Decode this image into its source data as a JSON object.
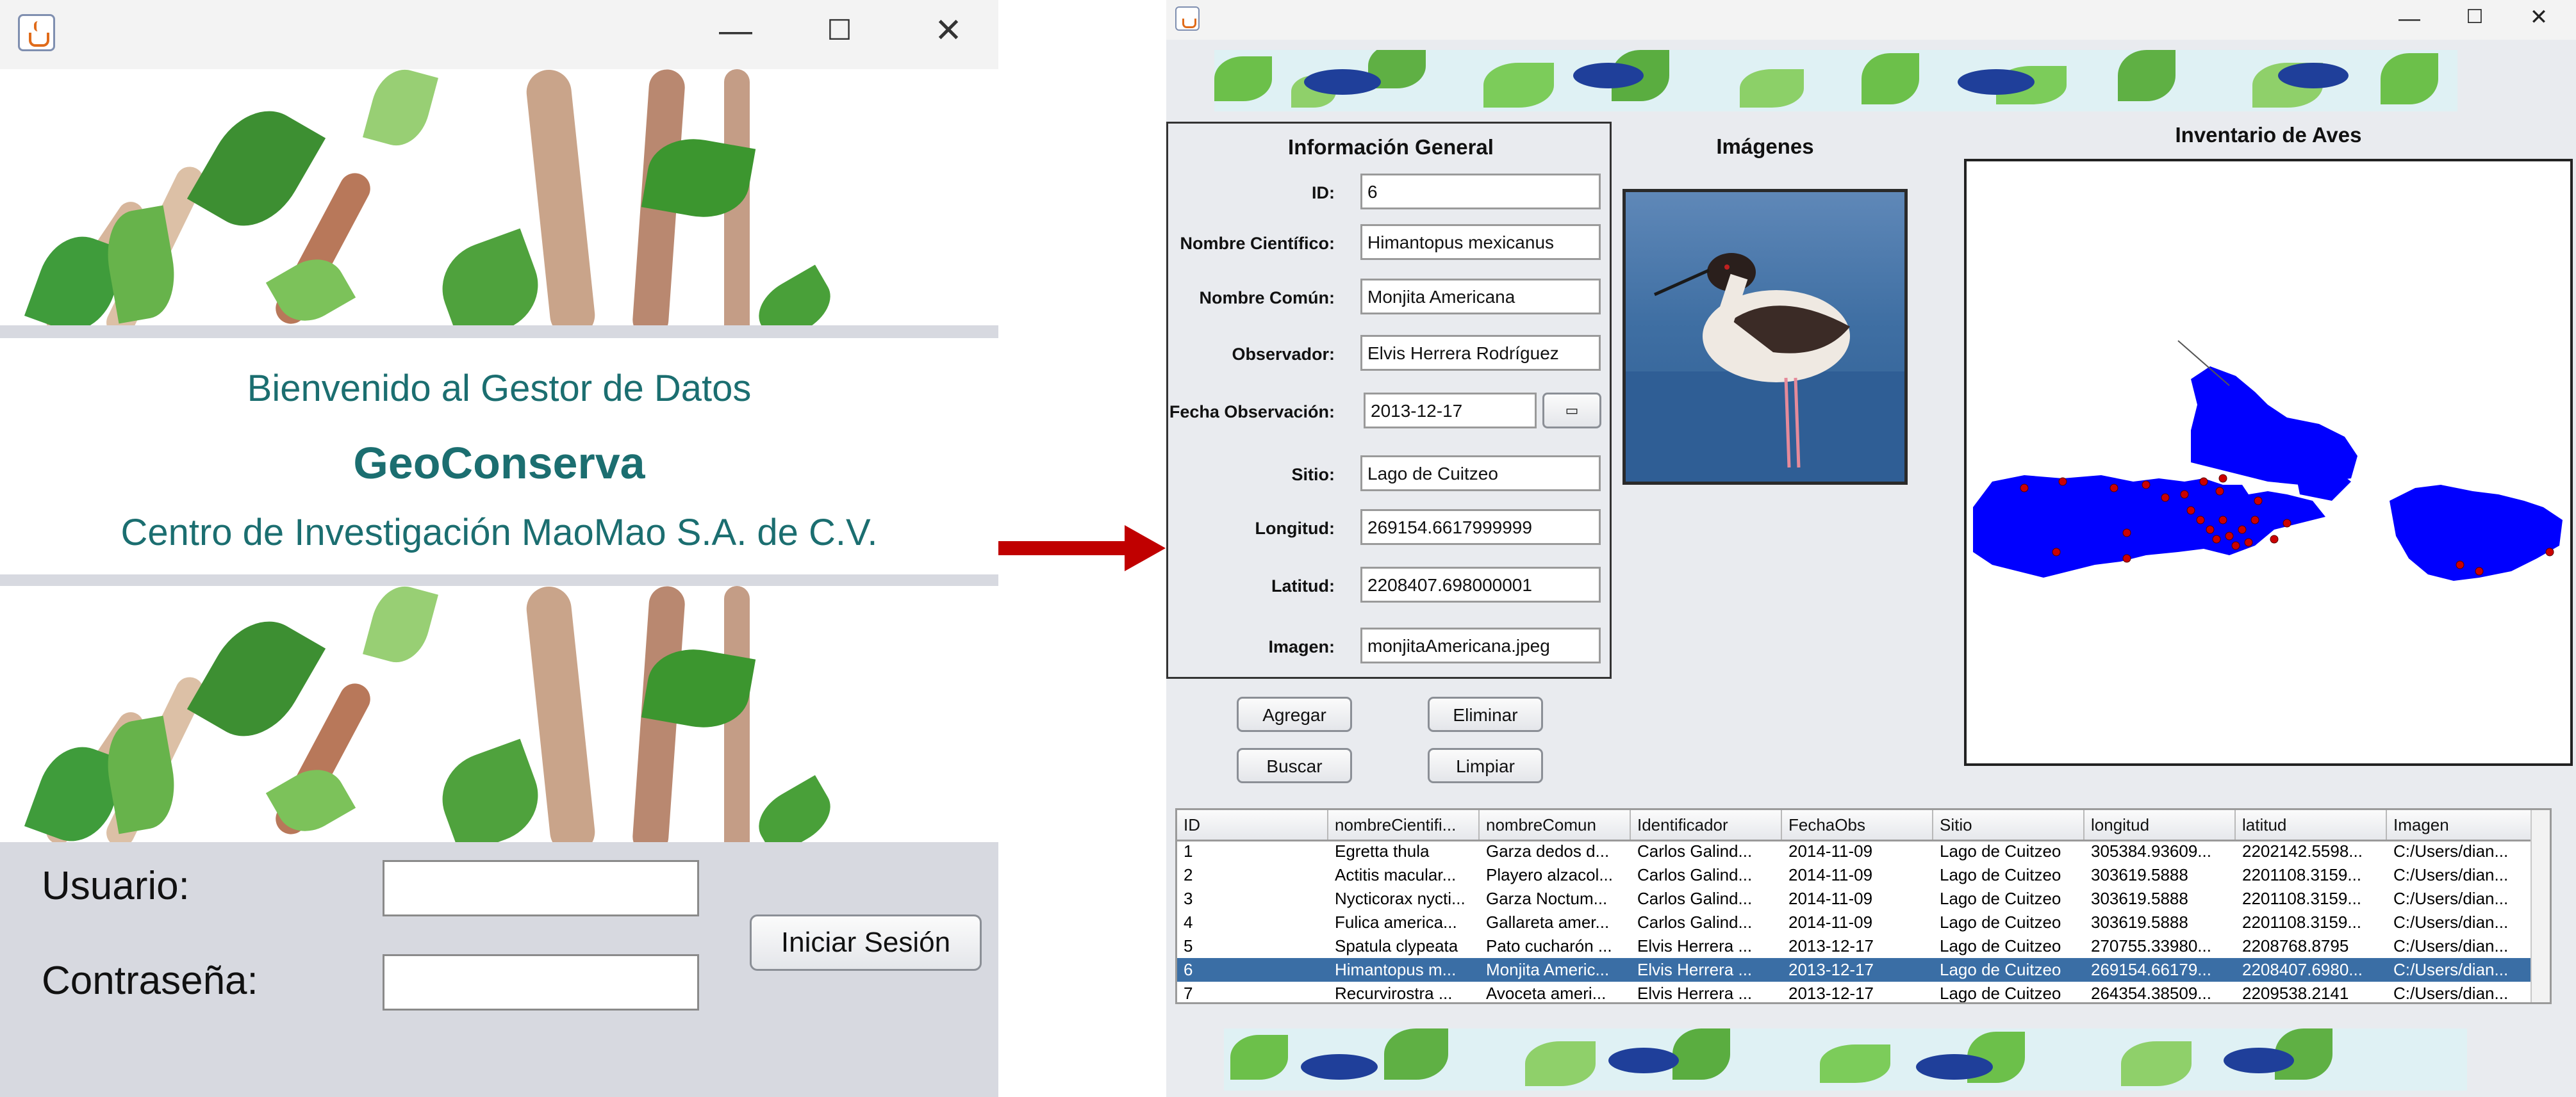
{
  "login": {
    "welcome": "Bienvenido al Gestor de Datos",
    "app_name": "GeoConserva",
    "org": "Centro de Investigación MaoMao S.A. de C.V.",
    "user_label": "Usuario:",
    "user_value": "",
    "password_label": "Contraseña:",
    "password_value": "",
    "login_button": "Iniciar Sesión"
  },
  "main": {
    "info_title": "Información General",
    "images_title": "Imágenes",
    "map_title": "Inventario de Aves",
    "fields": [
      {
        "label": "ID:",
        "value": "6"
      },
      {
        "label": "Nombre Científico:",
        "value": "Himantopus mexicanus"
      },
      {
        "label": "Nombre Común:",
        "value": "Monjita Americana"
      },
      {
        "label": "Observador:",
        "value": "Elvis Herrera Rodríguez"
      },
      {
        "label": "Fecha Observación:",
        "value": "2013-12-17"
      },
      {
        "label": "Sitio:",
        "value": "Lago de Cuitzeo"
      },
      {
        "label": "Longitud:",
        "value": "269154.6617999999"
      },
      {
        "label": "Latitud:",
        "value": "2208407.698000001"
      },
      {
        "label": "Imagen:",
        "value": "monjitaAmericana.jpeg"
      }
    ],
    "buttons": {
      "agregar": "Agregar",
      "eliminar": "Eliminar",
      "buscar": "Buscar",
      "limpiar": "Limpiar"
    },
    "table": {
      "columns": [
        "ID",
        "nombreCientifi...",
        "nombreComun",
        "Identificador",
        "FechaObs",
        "Sitio",
        "longitud",
        "latitud",
        "Imagen"
      ],
      "rows": [
        [
          "1",
          "Egretta thula",
          "Garza dedos d...",
          "Carlos Galind...",
          "2014-11-09",
          "Lago de Cuitzeo",
          "305384.93609...",
          "2202142.5598...",
          "C:/Users/dian..."
        ],
        [
          "2",
          "Actitis macular...",
          "Playero alzacol...",
          "Carlos Galind...",
          "2014-11-09",
          "Lago de Cuitzeo",
          "303619.5888",
          "2201108.3159...",
          "C:/Users/dian..."
        ],
        [
          "3",
          "Nycticorax nycti...",
          "Garza Noctum...",
          "Carlos Galind...",
          "2014-11-09",
          "Lago de Cuitzeo",
          "303619.5888",
          "2201108.3159...",
          "C:/Users/dian..."
        ],
        [
          "4",
          "Fulica america...",
          "Gallareta amer...",
          "Carlos Galind...",
          "2014-11-09",
          "Lago de Cuitzeo",
          "303619.5888",
          "2201108.3159...",
          "C:/Users/dian..."
        ],
        [
          "5",
          "Spatula clypeata",
          "Pato cucharón ...",
          "Elvis Herrera ...",
          "2013-12-17",
          "Lago de Cuitzeo",
          "270755.33980...",
          "2208768.8795",
          "C:/Users/dian..."
        ],
        [
          "6",
          "Himantopus m...",
          "Monjita Americ...",
          "Elvis Herrera ...",
          "2013-12-17",
          "Lago de Cuitzeo",
          "269154.66179...",
          "2208407.6980...",
          "C:/Users/dian..."
        ],
        [
          "7",
          "Recurvirostra ...",
          "Avoceta ameri...",
          "Elvis Herrera ...",
          "2013-12-17",
          "Lago de Cuitzeo",
          "264354.38509...",
          "2209538.2141",
          "C:/Users/dian..."
        ]
      ],
      "selected_row": 6
    }
  },
  "colors": {
    "title_teal": "#1b6e70",
    "map_blue": "#0000ff",
    "point_red": "#cc0000",
    "selection": "#3a6ea5",
    "arrow": "#c00000"
  },
  "icons": [
    "java-app-icon",
    "minimize-icon",
    "maximize-icon",
    "close-icon",
    "calendar-icon",
    "arrow-right-icon"
  ]
}
